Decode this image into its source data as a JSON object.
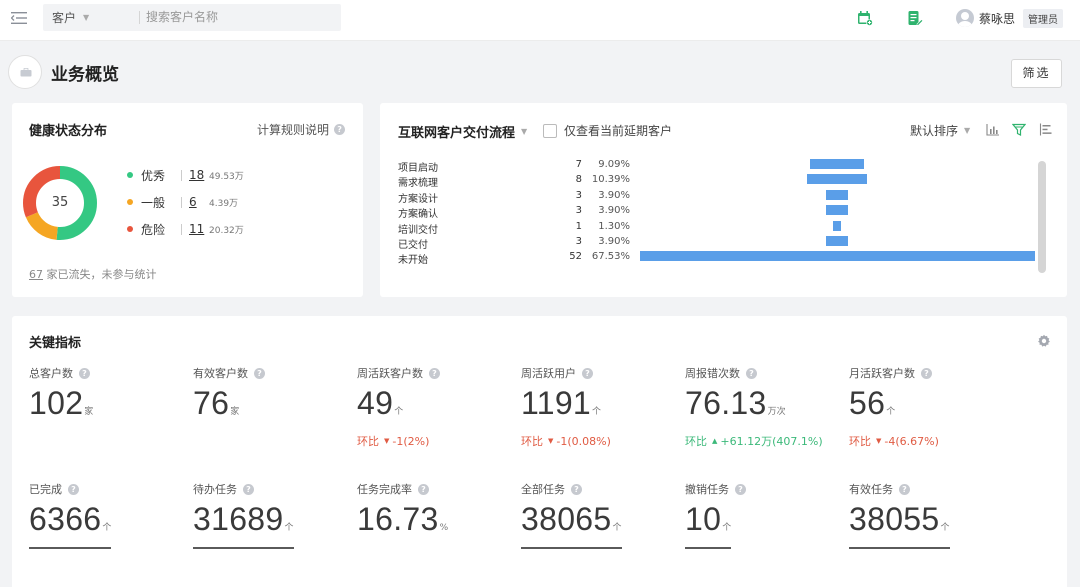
{
  "topbar": {
    "search_scope": "客户",
    "search_placeholder": "搜索客户名称",
    "user_name": "蔡咏思",
    "user_role": "管理员"
  },
  "page": {
    "title": "业务概览",
    "filter_button": "筛选"
  },
  "health": {
    "title": "健康状态分布",
    "rule_link": "计算规则说明",
    "total": "35",
    "items": [
      {
        "label": "优秀",
        "count": "18",
        "amount": "49.53万",
        "color": "#34c883"
      },
      {
        "label": "一般",
        "count": "6",
        "amount": "4.39万",
        "color": "#f5a623"
      },
      {
        "label": "危险",
        "count": "11",
        "amount": "20.32万",
        "color": "#e8553d"
      }
    ],
    "lost_count": "67",
    "lost_text": "家已流失，未参与统计"
  },
  "delivery": {
    "title": "互联网客户交付流程",
    "delay_checkbox_label": "仅查看当前延期客户",
    "delay_checked": false,
    "sort_label": "默认排序",
    "stages": [
      {
        "name": "项目启动",
        "count": "7",
        "pct": "9.09%"
      },
      {
        "name": "需求梳理",
        "count": "8",
        "pct": "10.39%"
      },
      {
        "name": "方案设计",
        "count": "3",
        "pct": "3.90%"
      },
      {
        "name": "方案确认",
        "count": "3",
        "pct": "3.90%"
      },
      {
        "name": "培训交付",
        "count": "1",
        "pct": "1.30%"
      },
      {
        "name": "已交付",
        "count": "3",
        "pct": "3.90%"
      },
      {
        "name": "未开始",
        "count": "52",
        "pct": "67.53%"
      }
    ],
    "bar_color": "#5a9ee8"
  },
  "metrics": {
    "title": "关键指标",
    "trend_prefix": "环比",
    "items": [
      {
        "label": "总客户数",
        "value": "102",
        "unit": "家"
      },
      {
        "label": "有效客户数",
        "value": "76",
        "unit": "家"
      },
      {
        "label": "周活跃客户数",
        "value": "49",
        "unit": "个",
        "trend": "-1(2%)",
        "dir": "down"
      },
      {
        "label": "周活跃用户",
        "value": "1191",
        "unit": "个",
        "trend": "-1(0.08%)",
        "dir": "down"
      },
      {
        "label": "周报错次数",
        "value": "76.13",
        "unit": "万次",
        "trend": "+61.12万(407.1%)",
        "dir": "up"
      },
      {
        "label": "月活跃客户数",
        "value": "56",
        "unit": "个",
        "trend": "-4(6.67%)",
        "dir": "down"
      },
      {
        "label": "已完成",
        "value": "6366",
        "unit": "个"
      },
      {
        "label": "待办任务",
        "value": "31689",
        "unit": "个"
      },
      {
        "label": "任务完成率",
        "value": "16.73",
        "unit": "%"
      },
      {
        "label": "全部任务",
        "value": "38065",
        "unit": "个"
      },
      {
        "label": "撤销任务",
        "value": "10",
        "unit": "个"
      },
      {
        "label": "有效任务",
        "value": "38055",
        "unit": "个"
      }
    ]
  },
  "colors": {
    "trend_down": "#e05b43",
    "trend_up": "#3cb97a",
    "brand_green": "#2fb36e"
  }
}
